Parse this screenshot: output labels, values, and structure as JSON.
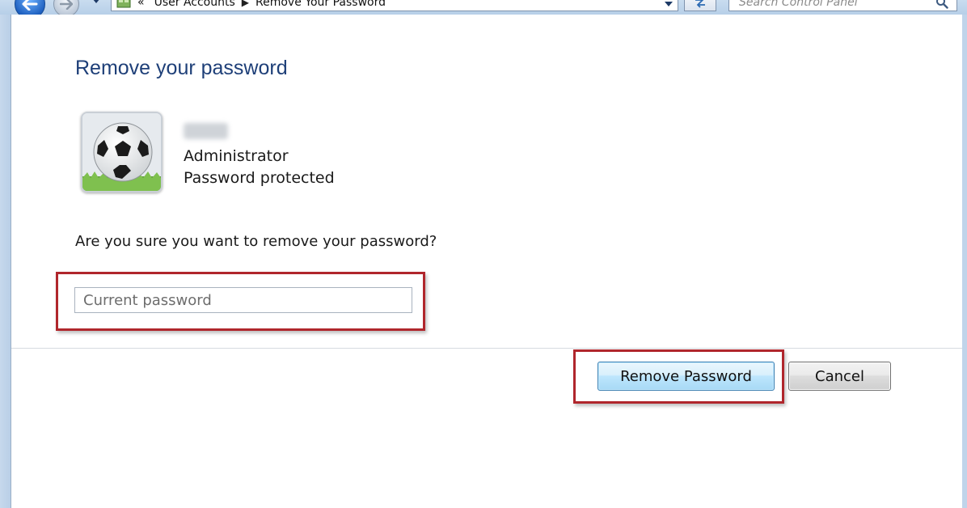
{
  "window": {
    "breadcrumb": [
      "«",
      "User Accounts",
      "Remove Your Password"
    ],
    "search_placeholder": "Search Control Panel"
  },
  "page": {
    "title": "Remove your password",
    "user": {
      "role": "Administrator",
      "status": "Password protected"
    },
    "question": "Are you sure you want to remove your password?",
    "password_field": {
      "placeholder": "Current password",
      "value": ""
    },
    "buttons": {
      "remove": "Remove Password",
      "cancel": "Cancel"
    }
  },
  "colors": {
    "title": "#1e3f78",
    "highlight": "#b0262c",
    "primary_button": "#bee6fd"
  },
  "icons": [
    "back-arrow-icon",
    "forward-arrow-icon",
    "control-panel-icon",
    "refresh-icon",
    "search-icon",
    "soccer-ball-avatar-icon"
  ]
}
